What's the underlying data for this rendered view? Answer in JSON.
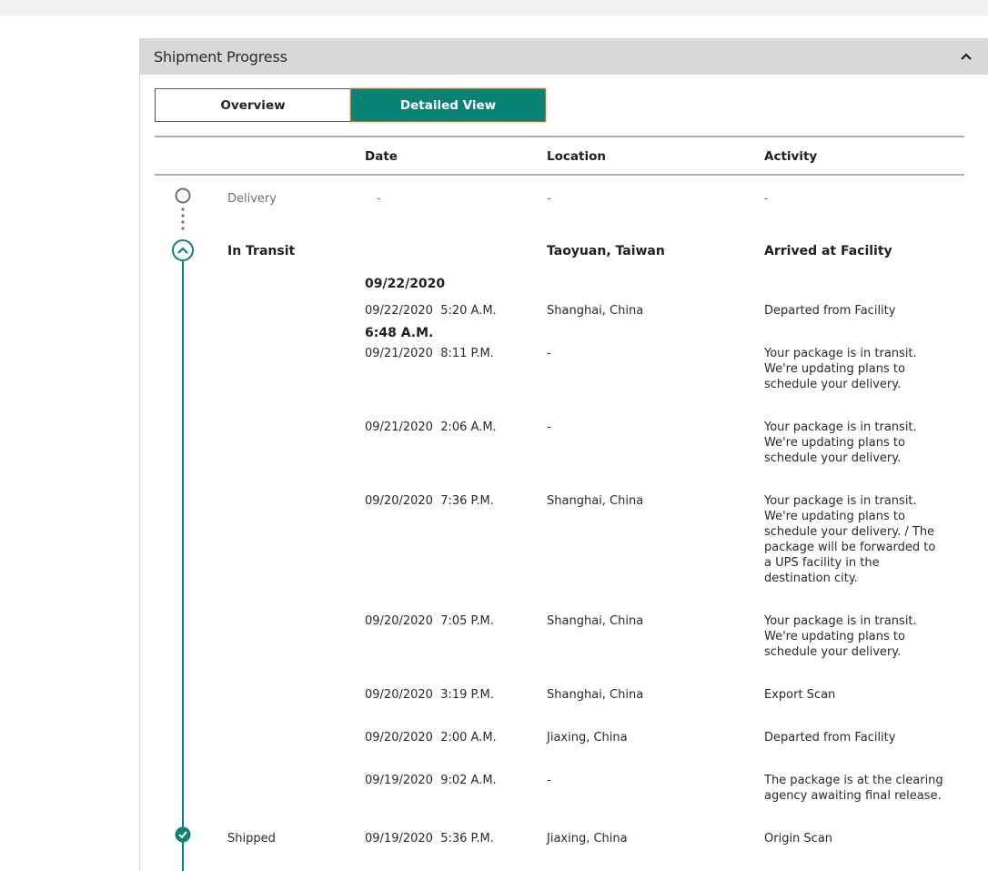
{
  "panel": {
    "title": "Shipment Progress",
    "accent_color": "#0a8276",
    "toggle": {
      "overview_label": "Overview",
      "detailed_label": "Detailed View",
      "selected": "Detailed View"
    }
  },
  "columns": {
    "date": "Date",
    "location": "Location",
    "activity": "Activity"
  },
  "stages": {
    "delivery": {
      "label": "Delivery",
      "date": "-",
      "location": "-",
      "activity": "-"
    },
    "in_transit": {
      "label": "In Transit",
      "date_line1": "09/22/2020",
      "date_line2": "6:48 A.M.",
      "location": "Taoyuan, Taiwan",
      "activity": "Arrived at Facility"
    },
    "shipped": {
      "label": "Shipped",
      "date": "09/19/2020  5:36 P.M.",
      "location": "Jiaxing, China",
      "activity": "Origin Scan"
    }
  },
  "events": [
    {
      "date": "09/22/2020  5:20 A.M.",
      "location": "Shanghai, China",
      "activity": "Departed from Facility"
    },
    {
      "date": "09/21/2020  8:11 P.M.",
      "location": "-",
      "activity": "Your package is in transit. We're updating plans to schedule your delivery."
    },
    {
      "date": "09/21/2020  2:06 A.M.",
      "location": "-",
      "activity": "Your package is in transit. We're updating plans to schedule your delivery."
    },
    {
      "date": "09/20/2020  7:36 P.M.",
      "location": "Shanghai, China",
      "activity": "Your package is in transit. We're updating plans to schedule your delivery. / The package will be forwarded to a UPS facility in the destination city."
    },
    {
      "date": "09/20/2020  7:05 P.M.",
      "location": "Shanghai, China",
      "activity": "Your package is in transit. We're updating plans to schedule your delivery."
    },
    {
      "date": "09/20/2020  3:19 P.M.",
      "location": "Shanghai, China",
      "activity": "Export Scan"
    },
    {
      "date": "09/20/2020  2:00 A.M.",
      "location": "Jiaxing, China",
      "activity": "Departed from Facility"
    },
    {
      "date": "09/19/2020  9:02 A.M.",
      "location": "-",
      "activity": "The package is at the clearing agency awaiting final release."
    }
  ]
}
